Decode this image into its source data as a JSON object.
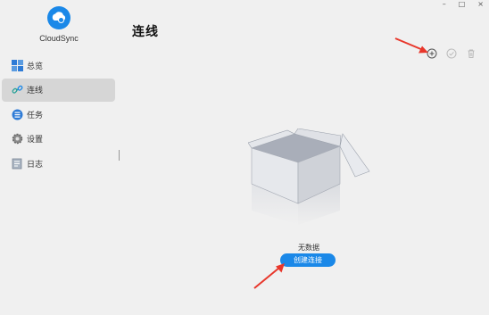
{
  "window": {
    "minimize": "–",
    "maximize": "□",
    "close": "×"
  },
  "app": {
    "name": "CloudSync"
  },
  "sidebar": {
    "items": [
      {
        "label": "总览",
        "icon": "overview-icon"
      },
      {
        "label": "连线",
        "icon": "link-icon",
        "active": true
      },
      {
        "label": "任务",
        "icon": "task-icon"
      },
      {
        "label": "设置",
        "icon": "settings-icon"
      },
      {
        "label": "日志",
        "icon": "log-icon"
      }
    ]
  },
  "page": {
    "title": "连线"
  },
  "toolbar": {
    "add": "add-icon",
    "check": "check-icon",
    "delete": "trash-icon"
  },
  "empty": {
    "text": "无数据",
    "button": "创建连接"
  },
  "colors": {
    "accent": "#1a88e8",
    "annotation": "#e8372b"
  }
}
